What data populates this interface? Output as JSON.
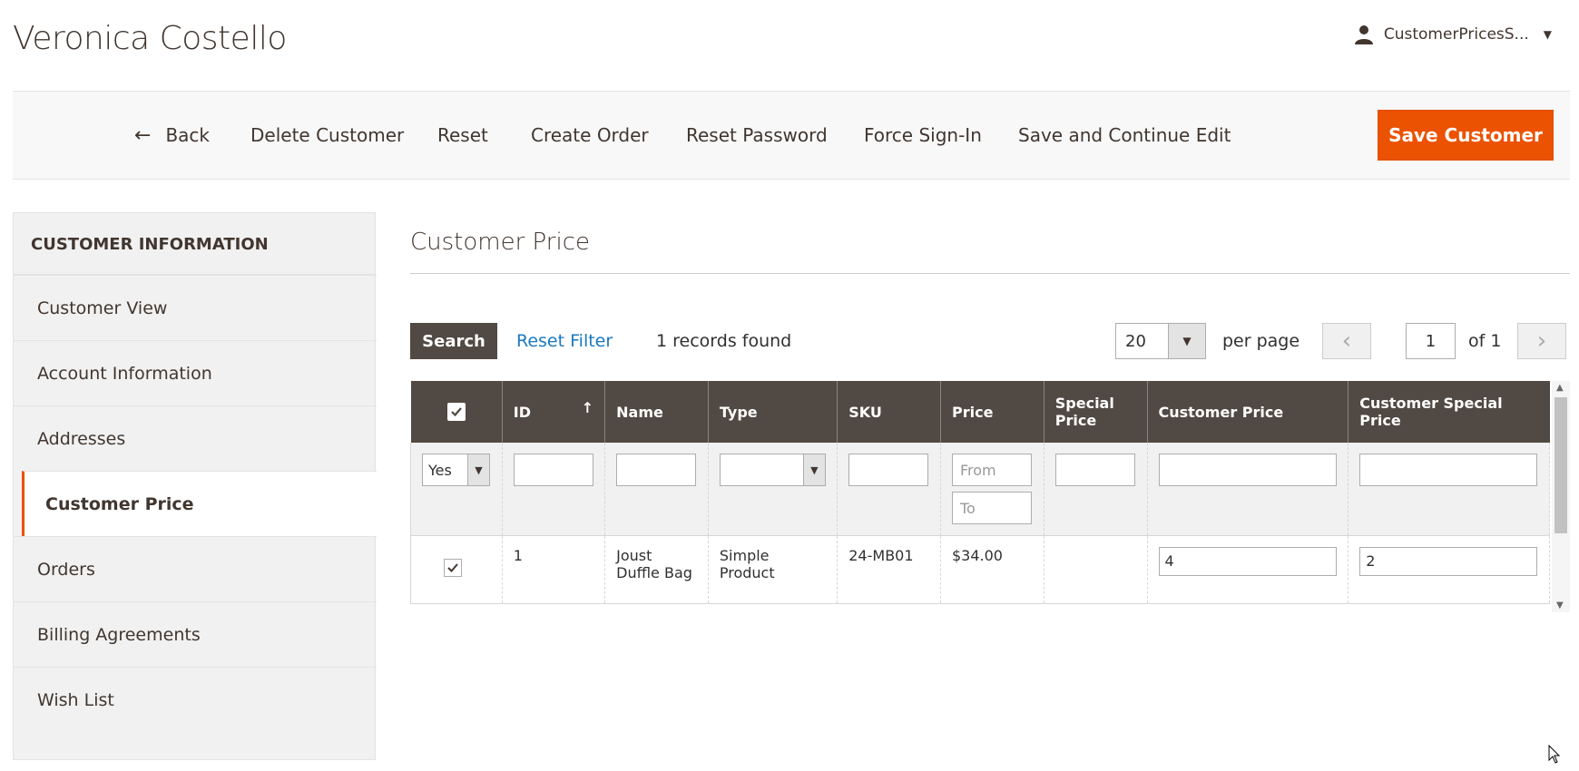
{
  "page": {
    "title": "Veronica Costello"
  },
  "user": {
    "name": "CustomerPricesS..."
  },
  "actions": {
    "back": "Back",
    "delete": "Delete Customer",
    "reset": "Reset",
    "create_order": "Create Order",
    "reset_password": "Reset Password",
    "force_sign_in": "Force Sign-In",
    "save_continue": "Save and Continue Edit",
    "save": "Save Customer"
  },
  "sidebar": {
    "title": "CUSTOMER INFORMATION",
    "items": [
      {
        "label": "Customer View"
      },
      {
        "label": "Account Information"
      },
      {
        "label": "Addresses"
      },
      {
        "label": "Customer Price"
      },
      {
        "label": "Orders"
      },
      {
        "label": "Billing Agreements"
      },
      {
        "label": "Wish List"
      }
    ]
  },
  "content": {
    "section_title": "Customer Price",
    "toolbar": {
      "search": "Search",
      "reset_filter": "Reset Filter",
      "records": "1 records found",
      "per_page_value": "20",
      "per_page_label": "per page",
      "page_value": "1",
      "page_total": "of 1"
    },
    "grid": {
      "columns": {
        "id": "ID",
        "name": "Name",
        "type": "Type",
        "sku": "SKU",
        "price": "Price",
        "special_price": "Special Price",
        "customer_price": "Customer Price",
        "customer_special_price": "Customer Special Price"
      },
      "filters": {
        "in_products": "Yes",
        "price_from_placeholder": "From",
        "price_to_placeholder": "To"
      },
      "rows": [
        {
          "id": "1",
          "name": "Joust Duffle Bag",
          "type": "Simple Product",
          "sku": "24-MB01",
          "price": "$34.00",
          "special_price": "",
          "customer_price": "4",
          "customer_special_price": "2"
        }
      ]
    }
  },
  "colors": {
    "accent": "#eb5202",
    "header_bg": "#514943",
    "link": "#1979c3"
  }
}
